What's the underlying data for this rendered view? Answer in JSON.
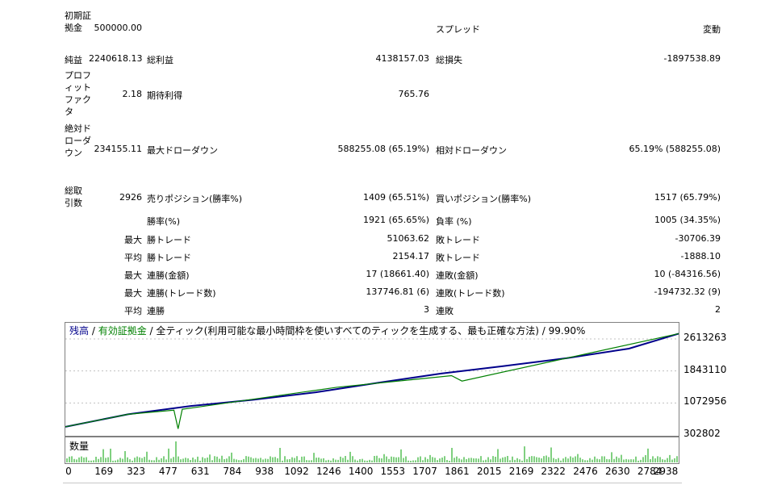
{
  "report": {
    "initial_deposit": {
      "label": "初期証拠金",
      "value": "500000.00"
    },
    "spread": {
      "label": "スプレッド",
      "value": "変動"
    },
    "net_profit": {
      "label": "純益",
      "value": "2240618.13"
    },
    "gross_profit": {
      "label": "総利益",
      "value": "4138157.03"
    },
    "gross_loss": {
      "label": "総損失",
      "value": "-1897538.89"
    },
    "profit_factor": {
      "label": "プロフィットファクタ",
      "value": "2.18"
    },
    "expected_payoff": {
      "label": "期待利得",
      "value": "765.76"
    },
    "abs_drawdown": {
      "label": "絶対ドローダウン",
      "value": "234155.11"
    },
    "max_drawdown": {
      "label": "最大ドローダウン",
      "value": "588255.08 (65.19%)"
    },
    "rel_drawdown": {
      "label": "相対ドローダウン",
      "value": "65.19% (588255.08)"
    },
    "total_trades": {
      "label": "総取引数",
      "value": "2926"
    },
    "short_positions": {
      "label": "売りポジション(勝率%)",
      "value": "1409 (65.51%)"
    },
    "long_positions": {
      "label": "買いポジション(勝率%)",
      "value": "1517 (65.79%)"
    },
    "win_rate": {
      "label": "勝率(%)",
      "value": "1921 (65.65%)"
    },
    "loss_rate": {
      "label": "負率 (%)",
      "value": "1005 (34.35%)"
    },
    "largest_win": {
      "prefix": "最大",
      "label": "勝トレード",
      "value": "51063.62"
    },
    "largest_loss": {
      "label": "敗トレード",
      "value": "-30706.39"
    },
    "average_win": {
      "prefix": "平均",
      "label": "勝トレード",
      "value": "2154.17"
    },
    "average_loss": {
      "label": "敗トレード",
      "value": "-1888.10"
    },
    "max_consec_wins_amount": {
      "prefix": "最大",
      "label": "連勝(金額)",
      "value": "17 (18661.40)"
    },
    "max_consec_losses_amount": {
      "label": "連敗(金額)",
      "value": "10 (-84316.56)"
    },
    "max_consec_wins_trades": {
      "prefix": "最大",
      "label": "連勝(トレード数)",
      "value": "137746.81 (6)"
    },
    "max_consec_losses_trades": {
      "label": "連敗(トレード数)",
      "value": "-194732.32 (9)"
    },
    "avg_consec_wins": {
      "prefix": "平均",
      "label": "連勝",
      "value": "3"
    },
    "avg_consec_losses": {
      "label": "連敗",
      "value": "2"
    }
  },
  "chart": {
    "legend": {
      "balance": "残高",
      "sep1": " / ",
      "equity": "有効証拠金",
      "sep2": " / ",
      "mode": "全ティック(利用可能な最小時間枠を使いすべてのティックを生成する、最も正確な方法)",
      "sep3": " / ",
      "quality": "99.90%"
    },
    "volume_label": "数量",
    "colors": {
      "balance": "#00008b",
      "equity": "#008000",
      "volume": "#00a000",
      "grid": "#c0c0c0"
    }
  },
  "chart_data": {
    "type": "line",
    "x_ticks": [
      "0",
      "169",
      "323",
      "477",
      "631",
      "784",
      "938",
      "1092",
      "1246",
      "1400",
      "1553",
      "1707",
      "1861",
      "2015",
      "2169",
      "2322",
      "2476",
      "2630",
      "2784",
      "2938"
    ],
    "y_ticks": [
      "2613263",
      "1843110",
      "1072956",
      "302802"
    ],
    "xlim": [
      0,
      2938
    ],
    "ylim": [
      302802,
      2613263
    ],
    "series": [
      {
        "name": "残高",
        "values": [
          [
            0,
            500000
          ],
          [
            300,
            800000
          ],
          [
            600,
            1000000
          ],
          [
            900,
            1150000
          ],
          [
            1200,
            1330000
          ],
          [
            1500,
            1560000
          ],
          [
            1800,
            1780000
          ],
          [
            2100,
            1960000
          ],
          [
            2400,
            2150000
          ],
          [
            2700,
            2380000
          ],
          [
            2938,
            2740618
          ]
        ]
      },
      {
        "name": "有効証拠金",
        "values": [
          [
            0,
            500000
          ],
          [
            300,
            800000
          ],
          [
            520,
            900000
          ],
          [
            540,
            450000
          ],
          [
            560,
            920000
          ],
          [
            1300,
            1450000
          ],
          [
            1850,
            1730000
          ],
          [
            1900,
            1600000
          ],
          [
            2938,
            2740618
          ]
        ]
      }
    ],
    "volume_label": "数量"
  }
}
